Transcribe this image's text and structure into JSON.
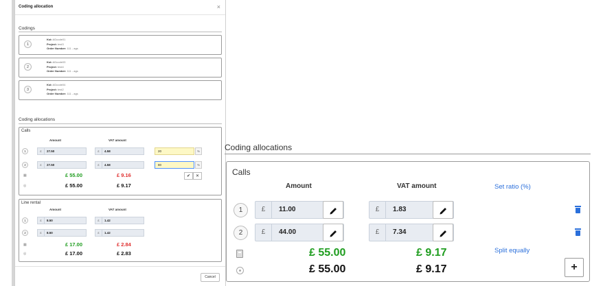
{
  "dialog": {
    "title": "Coding allocation",
    "close_symbol": "×",
    "codings_label": "Codings",
    "codings": [
      {
        "number": "1",
        "kst_label": "Kst:",
        "kst": "ADcode01",
        "project_label": "Project:",
        "project": "test3",
        "order_label": "Order Number:",
        "order": "111 - ags"
      },
      {
        "number": "2",
        "kst_label": "Kst:",
        "kst": "ADcode03",
        "project_label": "Project:",
        "project": "test4",
        "order_label": "Order Number:",
        "order": "111 - ags"
      },
      {
        "number": "3",
        "kst_label": "Kst:",
        "kst": "ADcode04",
        "project_label": "Project:",
        "project": "test2",
        "order_label": "Order Number:",
        "order": "111 - ags"
      }
    ],
    "allocations_label": "Coding allocations",
    "allocations": [
      {
        "name": "Calls",
        "amount_header": "Amount",
        "vat_header": "VAT amount",
        "rows": [
          {
            "number": "1",
            "currency": "£",
            "amount": "27.50",
            "vat": "4.58",
            "ratio": "20",
            "pct": "%"
          },
          {
            "number": "2",
            "currency": "£",
            "amount": "27.50",
            "vat": "4.58",
            "ratio": "80",
            "pct": "%"
          }
        ],
        "total_amount": "£ 55.00",
        "total_vat": "£ 9.16",
        "target_amount": "£ 55.00",
        "target_vat": "£ 9.17",
        "confirm_symbol": "✔",
        "cancel_symbol": "✕"
      },
      {
        "name": "Line rental",
        "amount_header": "Amount",
        "vat_header": "VAT amount",
        "rows": [
          {
            "number": "1",
            "currency": "£",
            "amount": "8.50",
            "vat": "1.42"
          },
          {
            "number": "2",
            "currency": "£",
            "amount": "8.50",
            "vat": "1.42"
          }
        ],
        "total_amount": "£ 17.00",
        "total_vat": "£ 2.84",
        "target_amount": "£ 17.00",
        "target_vat": "£ 2.83"
      }
    ],
    "cancel_label": "Cancel"
  },
  "zoom": {
    "title": "Coding allocations",
    "name": "Calls",
    "amount_header": "Amount",
    "vat_header": "VAT amount",
    "set_ratio_link": "Set ratio (%)",
    "split_link": "Split equally",
    "rows": [
      {
        "number": "1",
        "currency": "£",
        "amount": "11.00",
        "vat": "1.83"
      },
      {
        "number": "2",
        "currency": "£",
        "amount": "44.00",
        "vat": "7.34"
      }
    ],
    "total_amount": "£ 55.00",
    "total_vat": "£ 9.17",
    "target_amount": "£ 55.00",
    "target_vat": "£ 9.17",
    "add_symbol": "+"
  },
  "colors": {
    "ok_green": "#1f9d1f",
    "mismatch_red": "#e03030",
    "link_blue": "#2a6fdb",
    "ratio_yellow": "#fdf8c5",
    "field_grey": "#e8ecf2"
  },
  "icons": [
    "close-icon",
    "calculator-icon",
    "target-icon",
    "pencil-icon",
    "trash-icon",
    "plus-icon",
    "check-icon"
  ]
}
